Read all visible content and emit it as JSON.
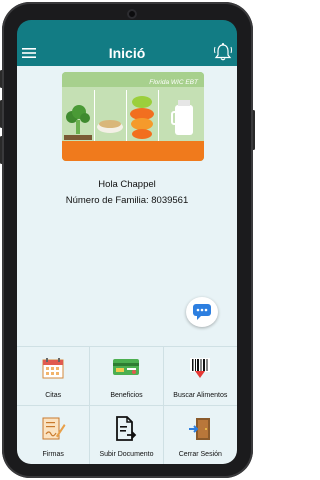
{
  "app": {
    "title": "Inició"
  },
  "banner": {
    "text": "Florida WIC EBT"
  },
  "greeting": {
    "hello": "Hola Chappel",
    "family": "Número de Familia: 8039561"
  },
  "menu": [
    {
      "label": "Citas",
      "icon": "calendar-icon"
    },
    {
      "label": "Beneficios",
      "icon": "benefits-card-icon"
    },
    {
      "label": "Buscar Alimentos",
      "icon": "barcode-scan-icon"
    },
    {
      "label": "Firmas",
      "icon": "signature-icon"
    },
    {
      "label": "Subir Documento",
      "icon": "upload-document-icon"
    },
    {
      "label": "Cerrar Sesión",
      "icon": "logout-door-icon"
    }
  ],
  "colors": {
    "primary": "#127c84",
    "accent": "#f07a1c",
    "background": "#e8f3f6"
  }
}
